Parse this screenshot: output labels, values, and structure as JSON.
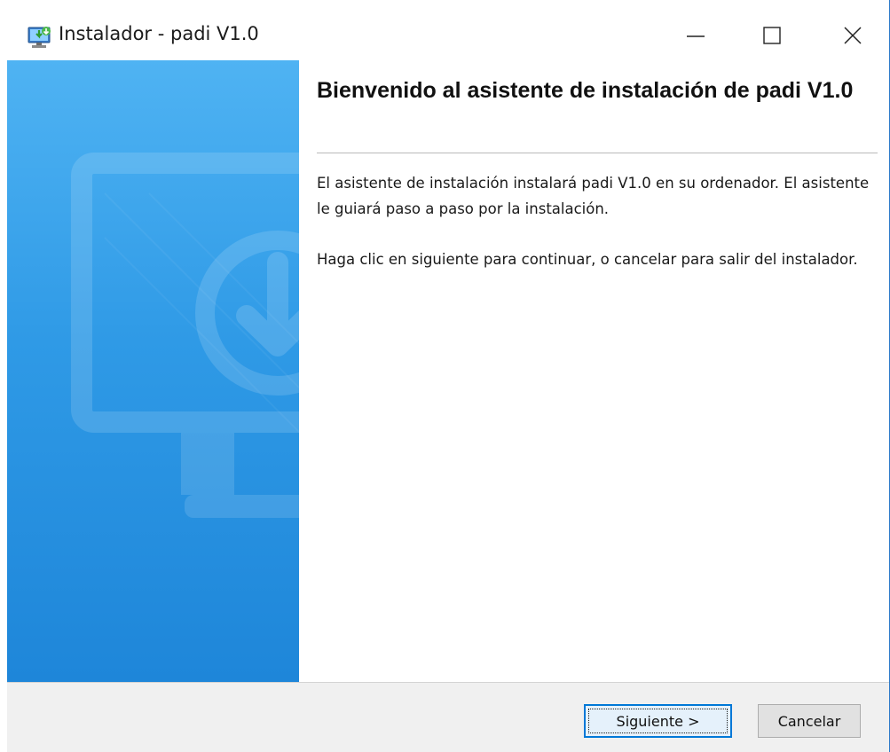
{
  "window": {
    "title": "Instalador - padi V1.0",
    "app_icon": "installer-monitor-icon",
    "controls": {
      "minimize_icon": "minimize-icon",
      "maximize_icon": "maximize-icon",
      "close_icon": "close-icon"
    }
  },
  "side_panel": {
    "illustration_icon": "monitor-download-icon"
  },
  "content": {
    "heading": "Bienvenido al asistente de instalación de padi V1.0",
    "paragraph1": "El asistente de instalación instalará padi V1.0 en su ordenador. El asistente le guiará paso a paso por la instalación.",
    "paragraph2": "Haga clic en siguiente para continuar, o cancelar para salir del instalador."
  },
  "buttons": {
    "next_label": "Siguiente >",
    "cancel_label": "Cancelar"
  },
  "colors": {
    "accent": "#0078d7",
    "side_panel_top": "#4fb3f3",
    "side_panel_bottom": "#1e86d9"
  }
}
